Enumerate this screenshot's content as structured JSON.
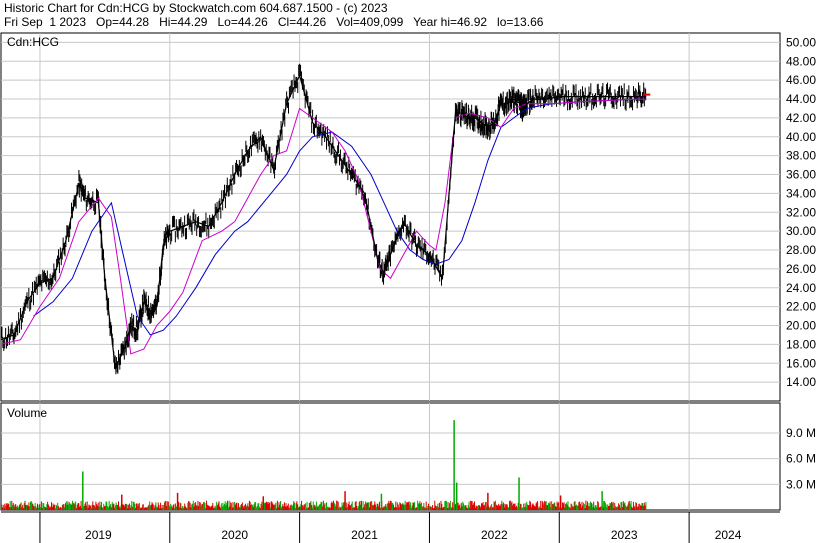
{
  "header": {
    "line1": "Historic Chart for Cdn:HCG by Stockwatch.com 604.687.1500 - (c) 2023",
    "line2": "Fri Sep  1 2023   Op=44.28   Hi=44.29   Lo=44.26   Cl=44.26   Vol=409,099   Year hi=46.92   lo=13.66"
  },
  "chart_data": [
    {
      "type": "line",
      "title": "Cdn:HCG",
      "ylim": [
        12,
        51
      ],
      "y_ticks": [
        "50.00",
        "48.00",
        "46.00",
        "44.00",
        "42.00",
        "40.00",
        "38.00",
        "36.00",
        "34.00",
        "32.00",
        "30.00",
        "28.00",
        "26.00",
        "24.00",
        "22.00",
        "20.00",
        "18.00",
        "16.00",
        "14.00"
      ],
      "y_tick_values": [
        50,
        48,
        46,
        44,
        42,
        40,
        38,
        36,
        34,
        32,
        30,
        28,
        26,
        24,
        22,
        20,
        18,
        16,
        14
      ],
      "x_labels": [
        "2019",
        "2020",
        "2021",
        "2022",
        "2023",
        "2024"
      ],
      "x_label_positions": [
        2019.45,
        2020.5,
        2021.5,
        2022.5,
        2023.5,
        2024.3
      ],
      "xlim": [
        2018.7,
        2024.7
      ],
      "grid": true,
      "series": [
        {
          "role": "price",
          "color": "#000000",
          "x": [
            2018.7,
            2018.8,
            2018.9,
            2019.0,
            2019.1,
            2019.2,
            2019.3,
            2019.35,
            2019.45,
            2019.5,
            2019.58,
            2019.65,
            2019.7,
            2019.75,
            2019.8,
            2019.85,
            2019.9,
            2019.95,
            2020.0,
            2020.1,
            2020.2,
            2020.3,
            2020.4,
            2020.5,
            2020.6,
            2020.7,
            2020.8,
            2020.9,
            2021.0,
            2021.1,
            2021.2,
            2021.3,
            2021.4,
            2021.5,
            2021.6,
            2021.65,
            2021.7,
            2021.8,
            2021.9,
            2022.0,
            2022.1,
            2022.2,
            2022.25,
            2022.3,
            2022.35,
            2022.4,
            2022.45,
            2022.5,
            2022.55,
            2022.6,
            2022.65,
            2022.7,
            2022.72,
            2022.75,
            2022.8,
            2022.9,
            2023.0,
            2023.1,
            2023.2,
            2023.3,
            2023.4,
            2023.5,
            2023.6,
            2023.67
          ],
          "values": [
            18.5,
            19.0,
            22.5,
            24.5,
            25.0,
            29.0,
            35.0,
            33.5,
            33.0,
            25.0,
            15.5,
            17.5,
            20.0,
            19.5,
            22.5,
            21.5,
            22.0,
            28.5,
            30.0,
            30.5,
            31.0,
            30.5,
            33.0,
            36.0,
            38.5,
            40.0,
            36.5,
            43.5,
            46.5,
            41.5,
            40.0,
            38.0,
            36.0,
            34.0,
            27.0,
            25.5,
            27.5,
            31.0,
            28.5,
            27.5,
            25.0,
            42.5,
            42.5,
            42.0,
            42.0,
            41.5,
            41.0,
            41.5,
            43.5,
            43.5,
            44.0,
            43.5,
            43.0,
            43.5,
            44.0,
            44.0,
            44.26,
            44.26,
            44.26,
            44.26,
            44.26,
            44.26,
            44.26,
            44.26
          ]
        },
        {
          "role": "short-ma",
          "color": "#cc00cc",
          "x": [
            2018.7,
            2018.85,
            2019.0,
            2019.15,
            2019.3,
            2019.45,
            2019.55,
            2019.62,
            2019.7,
            2019.8,
            2019.9,
            2020.0,
            2020.1,
            2020.25,
            2020.4,
            2020.5,
            2020.6,
            2020.7,
            2020.8,
            2020.9,
            2021.0,
            2021.1,
            2021.25,
            2021.35,
            2021.45,
            2021.55,
            2021.62,
            2021.7,
            2021.8,
            2021.9,
            2022.0,
            2022.05,
            2022.12,
            2022.2,
            2022.3,
            2022.45,
            2022.55,
            2022.65,
            2022.75,
            2022.85,
            2022.95,
            2023.05,
            2023.15,
            2023.3,
            2023.45,
            2023.6,
            2023.67
          ],
          "values": [
            18.0,
            18.5,
            22.0,
            25.0,
            31.0,
            33.5,
            31.5,
            25.0,
            17.0,
            17.5,
            20.0,
            21.5,
            23.5,
            29.0,
            30.0,
            31.0,
            33.5,
            36.0,
            38.0,
            38.5,
            43.0,
            42.0,
            40.5,
            38.5,
            35.5,
            30.0,
            26.0,
            25.0,
            27.5,
            30.0,
            28.5,
            28.0,
            33.0,
            42.0,
            42.5,
            42.0,
            41.0,
            43.0,
            43.5,
            43.5,
            43.5,
            43.6,
            43.7,
            43.8,
            43.9,
            44.0,
            44.0
          ]
        },
        {
          "role": "long-ma",
          "color": "#0000cc",
          "x": [
            2018.95,
            2019.1,
            2019.25,
            2019.4,
            2019.55,
            2019.65,
            2019.75,
            2019.85,
            2019.95,
            2020.05,
            2020.2,
            2020.35,
            2020.5,
            2020.6,
            2020.75,
            2020.9,
            2021.0,
            2021.1,
            2021.25,
            2021.4,
            2021.55,
            2021.65,
            2021.75,
            2021.85,
            2021.95,
            2022.05,
            2022.15,
            2022.25,
            2022.35,
            2022.45,
            2022.55,
            2022.65,
            2022.75,
            2022.85,
            2022.95,
            2023.05,
            2023.15,
            2023.3,
            2023.45,
            2023.6,
            2023.67
          ],
          "values": [
            21.0,
            22.5,
            25.0,
            30.0,
            33.0,
            27.0,
            21.0,
            19.0,
            19.5,
            21.0,
            24.0,
            27.5,
            30.0,
            31.0,
            33.5,
            36.0,
            38.5,
            40.0,
            40.5,
            39.0,
            36.0,
            33.0,
            30.0,
            28.0,
            27.0,
            26.5,
            27.0,
            29.0,
            33.0,
            37.5,
            41.0,
            42.0,
            43.0,
            43.3,
            43.5,
            43.6,
            43.7,
            43.8,
            43.9,
            44.0,
            44.0
          ]
        }
      ]
    },
    {
      "type": "bar",
      "title": "Volume",
      "ylim": [
        0,
        12.5
      ],
      "y_ticks": [
        "9.0 M",
        "6.0 M",
        "3.0 M"
      ],
      "y_tick_values": [
        9,
        6,
        3
      ],
      "colors": {
        "up": "#00aa00",
        "down": "#dd0000"
      },
      "spikes": [
        {
          "x": 2019.33,
          "value": 4.5,
          "dir": "up"
        },
        {
          "x": 2019.63,
          "value": 1.8,
          "dir": "down"
        },
        {
          "x": 2020.06,
          "value": 2.0,
          "dir": "down"
        },
        {
          "x": 2020.72,
          "value": 1.6,
          "dir": "down"
        },
        {
          "x": 2021.35,
          "value": 2.2,
          "dir": "down"
        },
        {
          "x": 2021.63,
          "value": 1.9,
          "dir": "up"
        },
        {
          "x": 2022.19,
          "value": 10.5,
          "dir": "up"
        },
        {
          "x": 2022.21,
          "value": 3.2,
          "dir": "up"
        },
        {
          "x": 2022.45,
          "value": 2.0,
          "dir": "down"
        },
        {
          "x": 2022.69,
          "value": 3.8,
          "dir": "up"
        },
        {
          "x": 2023.01,
          "value": 1.7,
          "dir": "down"
        },
        {
          "x": 2023.33,
          "value": 2.2,
          "dir": "up"
        }
      ]
    }
  ]
}
